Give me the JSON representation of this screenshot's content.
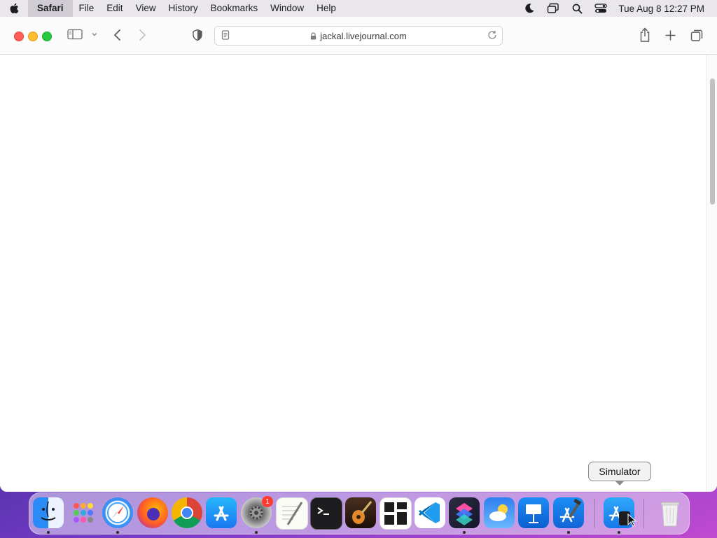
{
  "menubar": {
    "app_name": "Safari",
    "items": [
      "File",
      "Edit",
      "View",
      "History",
      "Bookmarks",
      "Window",
      "Help"
    ],
    "clock": "Tue Aug 8  12:27 PM",
    "status_icons": [
      "moon-icon",
      "screen-mirroring-icon",
      "spotlight-search-icon",
      "control-center-icon"
    ]
  },
  "browser": {
    "url": "jackal.livejournal.com"
  },
  "dock": {
    "apps": [
      "Finder",
      "Launchpad",
      "Safari",
      "Firefox",
      "Google Chrome",
      "App Store",
      "System Settings",
      "TextEdit",
      "Terminal",
      "GarageBand",
      "Tableplus",
      "Visual Studio Code",
      "Shortcuts",
      "Weather",
      "Keynote",
      "Xcode",
      "Simulator",
      "Trash"
    ],
    "system_settings_badge": "1",
    "tooltip": "Simulator"
  },
  "colors": {
    "close": "#fe5f57",
    "minimize": "#febc2e",
    "zoom": "#28c840",
    "badge": "#ff3b30"
  }
}
